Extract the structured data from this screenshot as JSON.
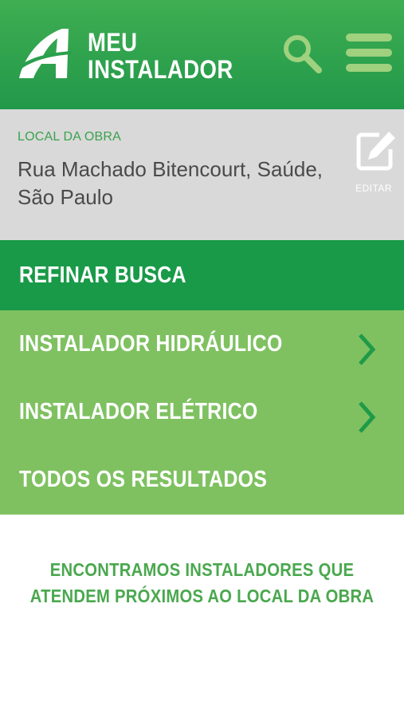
{
  "header": {
    "brand_line1": "MEU",
    "brand_line2": "INSTALADOR",
    "logo_icon": "stylized-a-logo",
    "search_icon": "search-icon",
    "menu_icon": "hamburger-menu-icon"
  },
  "location": {
    "label": "LOCAL DA OBRA",
    "address": "Rua Machado Bitencourt, Saúde, São Paulo",
    "edit_label": "EDITAR",
    "edit_icon": "edit-icon"
  },
  "refine": {
    "label": "REFINAR BUSCA"
  },
  "options": [
    {
      "label": "INSTALADOR HIDRÁULICO",
      "has_chevron": true
    },
    {
      "label": "INSTALADOR ELÉTRICO",
      "has_chevron": true
    },
    {
      "label": "TODOS OS RESULTADOS",
      "has_chevron": false
    }
  ],
  "result": {
    "line1": "ENCONTRAMOS INSTALADORES QUE",
    "line2": "ATENDEM PRÓXIMOS AO LOCAL DA OBRA"
  },
  "colors": {
    "header": "#2a9f4c",
    "location_bg": "#d9d9d9",
    "refine_bg": "#199a48",
    "options_bg": "#7fc161",
    "icon_light_green": "#9fd17e",
    "chevron": "#1f9a48",
    "result_text": "#4aa84e"
  }
}
